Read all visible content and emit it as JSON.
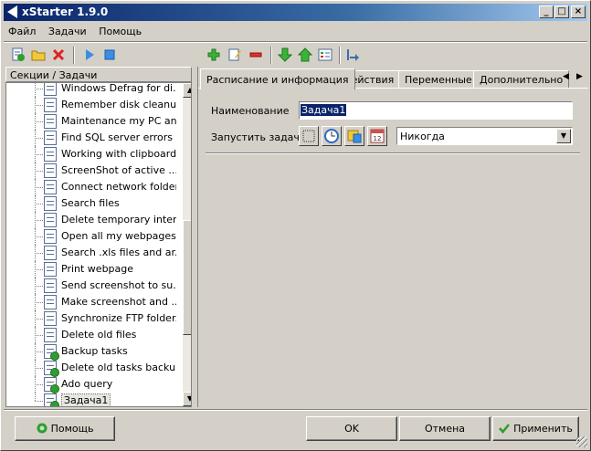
{
  "window": {
    "title": "xStarter 1.9.0",
    "controls": [
      "_",
      "□",
      "×"
    ]
  },
  "menu": [
    "Файл",
    "Задачи",
    "Помощь"
  ],
  "left_panel": {
    "header": "Секции / Задачи",
    "tasks": [
      {
        "label": "Windows Defrag for di...",
        "done": false
      },
      {
        "label": "Remember disk cleanu...",
        "done": false
      },
      {
        "label": "Maintenance my PC an...",
        "done": false
      },
      {
        "label": "Find SQL server errors",
        "done": false
      },
      {
        "label": "Working with clipboard...",
        "done": false
      },
      {
        "label": "ScreenShot of active ...",
        "done": false
      },
      {
        "label": "Connect network folders",
        "done": false
      },
      {
        "label": "Search files",
        "done": false
      },
      {
        "label": "Delete temporary inter...",
        "done": false
      },
      {
        "label": "Open all my webpages",
        "done": false
      },
      {
        "label": "Search .xls files and ar...",
        "done": false
      },
      {
        "label": "Print webpage",
        "done": false
      },
      {
        "label": "Send screenshot to su...",
        "done": false
      },
      {
        "label": "Make screenshot and ...",
        "done": false
      },
      {
        "label": "Synchronize FTP folder...",
        "done": false
      },
      {
        "label": "Delete old files",
        "done": false
      },
      {
        "label": "Backup tasks",
        "done": true
      },
      {
        "label": "Delete old tasks backups",
        "done": true
      },
      {
        "label": "Ado query",
        "done": true
      },
      {
        "label": "Задача1",
        "done": true,
        "selected": true
      }
    ]
  },
  "tabs": [
    "Расписание и информация",
    "Действия",
    "Переменные",
    "Дополнительно"
  ],
  "form": {
    "name_label": "Наименование",
    "name_value": "Задача1",
    "run_label": "Запустить задачу",
    "run_value": "Никогда"
  },
  "buttons": {
    "help": "Помощь",
    "ok": "OK",
    "cancel": "Отмена",
    "apply": "Применить"
  },
  "colors": {
    "title_start": "#0a246a",
    "title_end": "#a6caf0",
    "face": "#d4d0c8",
    "selection": "#0a246a",
    "check_green": "#2e9e2e"
  }
}
